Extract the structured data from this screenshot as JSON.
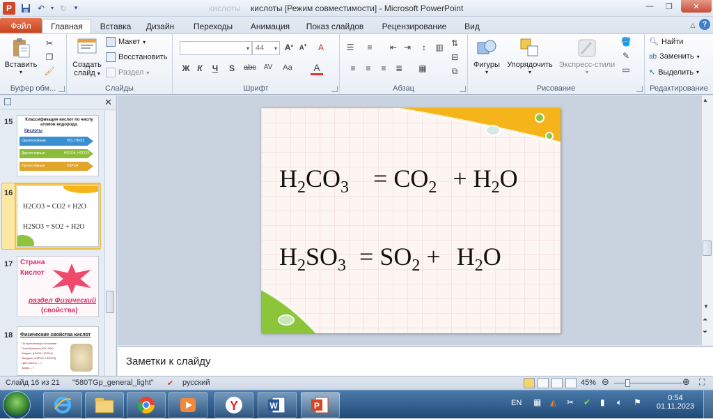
{
  "window": {
    "title": "кислоты [Режим совместимости]",
    "title_suffix": " -  Microsoft PowerPoint",
    "faint_prefix": "кислоты"
  },
  "tabs": [
    "Файл",
    "Главная",
    "Вставка",
    "Дизайн",
    "Переходы",
    "Анимация",
    "Показ слайдов",
    "Рецензирование",
    "Вид"
  ],
  "ribbon": {
    "clipboard": {
      "paste": "Вставить",
      "label": "Буфер обм..."
    },
    "slides": {
      "new_slide_line1": "Создать",
      "new_slide_line2": "слайд",
      "layout": "Макет",
      "reset": "Восстановить",
      "section": "Раздел",
      "label": "Слайды"
    },
    "font": {
      "size": "44",
      "bold": "Ж",
      "italic": "К",
      "underline": "Ч",
      "strike": "abc",
      "label": "Шрифт"
    },
    "paragraph": {
      "label": "Абзац"
    },
    "drawing": {
      "shapes": "Фигуры",
      "arrange": "Упорядочить",
      "styles": "Экспресс-стили",
      "label": "Рисование"
    },
    "editing": {
      "find": "Найти",
      "replace": "Заменить",
      "select": "Выделить",
      "label": "Редактирование"
    }
  },
  "thumbnails": [
    {
      "num": "15",
      "title": "Классификация  кислот по числу атомов  водорода.",
      "subtitle": "Кислоты",
      "rows": [
        {
          "label": "Одноосновные",
          "value": "HCl, HNO3",
          "color": "#3a8fd0"
        },
        {
          "label": "Двухосновные",
          "value": "H2SO4, H2CO3",
          "color": "#8dbb3a"
        },
        {
          "label": "Трехосновные",
          "value": "H3PO4",
          "color": "#e0a52a"
        }
      ]
    },
    {
      "num": "16",
      "line1": "H2CO3   = CO2  + H2O",
      "line2": "H2SO3  = SO2 +  H2O"
    },
    {
      "num": "17",
      "title1": "Страна",
      "title2": "Кислот",
      "sub1": "раздел  Физический",
      "sub2": "(свойства)"
    },
    {
      "num": "18",
      "title": "Физические свойства кислот",
      "items": [
        "По агрегатному состоянию:",
        "Газообразные (HCl, HBr)",
        "Жидкие (HNO3, H2SO4)",
        "Твердые (H3PO4, H2SiO3)",
        "Цвет кислот – ?",
        "Запах – ?"
      ]
    }
  ],
  "slide": {
    "eq1": {
      "a": "H",
      "a_sub": "2",
      "b": "CO",
      "b_sub": "3",
      "eq": "=",
      "c": "CO",
      "c_sub": "2",
      "plus": "+",
      "d": "H",
      "d_sub": "2",
      "e": "O"
    },
    "eq2": {
      "a": "H",
      "a_sub": "2",
      "b": "SO",
      "b_sub": "3",
      "eq": "=",
      "c": "SO",
      "c_sub": "2",
      "plus": "+",
      "d": "H",
      "d_sub": "2",
      "e": "O"
    }
  },
  "notes": {
    "placeholder": "Заметки к слайду"
  },
  "status": {
    "slide": "Слайд 16 из 21",
    "theme": "\"580TGp_general_light\"",
    "language": "русский",
    "zoom": "45%"
  },
  "taskbar": {
    "lang": "EN",
    "time": "0:54",
    "date": "01.11.2023"
  },
  "colors": {
    "accent": "#d24726",
    "slide_yellow": "#f4b41a",
    "slide_green": "#8cc43a"
  }
}
